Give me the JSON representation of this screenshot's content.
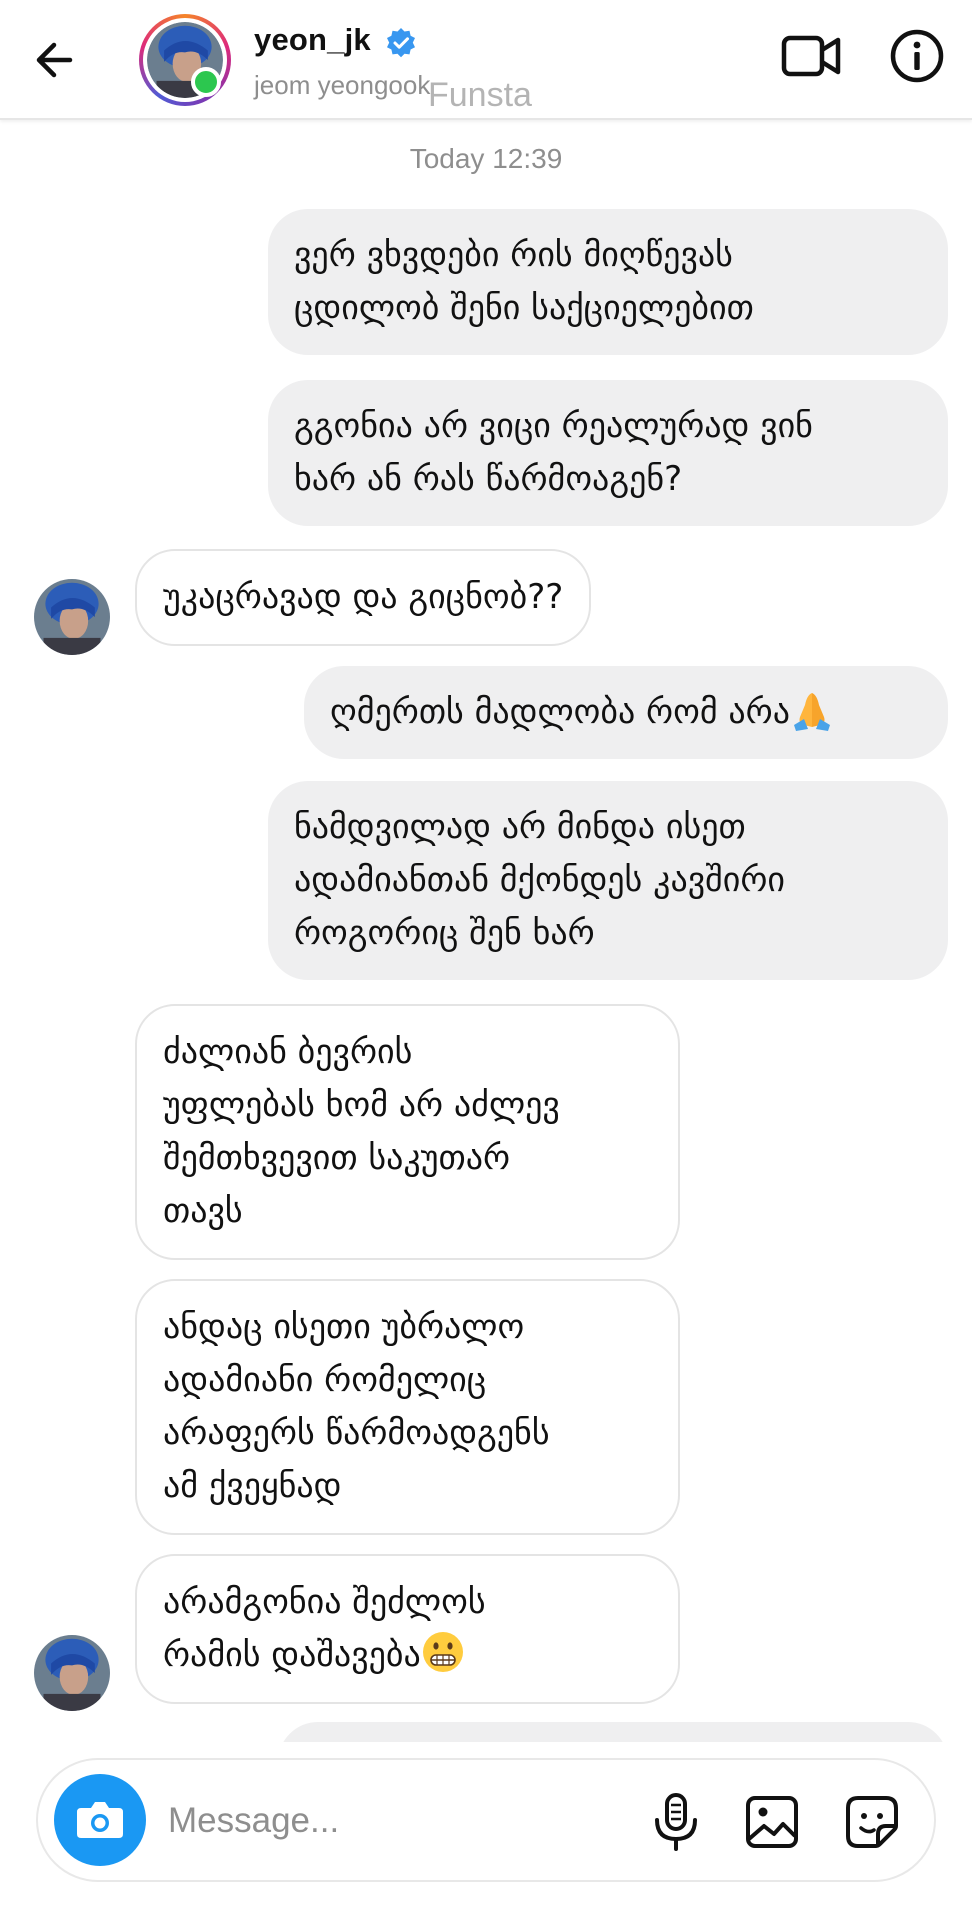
{
  "header": {
    "username": "yeon_jk",
    "full_name": "jeom yeongook",
    "watermark": "Funsta",
    "verified": true
  },
  "thread": {
    "timestamp": "Today 12:39",
    "messages": [
      {
        "direction": "out",
        "lines": "ვერ ვხვდები რის მიღწევას\nცდილობ შენი საქციელებით"
      },
      {
        "direction": "out",
        "lines": "გგონია არ ვიცი რეალურად ვინ\nხარ ან რას წარმოაგენ?"
      },
      {
        "direction": "in",
        "lines": "უკაცრავად და გიცნობ??"
      },
      {
        "direction": "out",
        "lines": "ღმერთს მადლობა რომ არა",
        "emoji": "folded-hands"
      },
      {
        "direction": "out",
        "lines": "ნამდვილად არ მინდა ისეთ\nადამიანთან მქონდეს კავშირი\nროგორიც შენ ხარ"
      },
      {
        "direction": "in",
        "lines": "ძალიან ბევრის\nუფლებას ხომ არ აძლევ\nშემთხვევით საკუთარ\nთავს"
      },
      {
        "direction": "in",
        "lines": "ანდაც ისეთი უბრალო\nადამიანი რომელიც\nარაფერს წარმოადგენს\nამ ქვეყნად"
      },
      {
        "direction": "in",
        "lines": "არამგონია შეძლოს\nრამის დაშავება",
        "emoji": "grimacing-face"
      }
    ]
  },
  "composer": {
    "placeholder": "Message..."
  },
  "colors": {
    "accent": "#1a98f3",
    "online": "#2cc74f",
    "verified": "#3897f0",
    "outgoing_bubble": "#efeff0"
  },
  "icons": [
    "back-arrow-icon",
    "video-call-icon",
    "info-icon",
    "camera-icon",
    "microphone-icon",
    "gallery-icon",
    "sticker-icon",
    "verified-badge-icon"
  ]
}
